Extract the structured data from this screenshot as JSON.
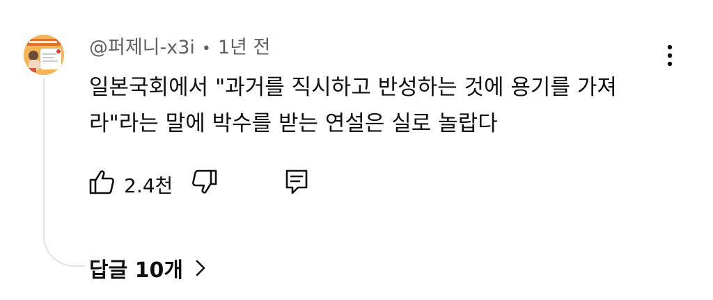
{
  "comment": {
    "author": "@퍼제니-x3i",
    "separator": "•",
    "time": "1년 전",
    "text": "일본국회에서 \"과거를 직시하고 반성하는 것에 용기를 가져라\"라는 말에 박수를 받는 연설은 실로 놀랍다",
    "like_count": "2.4천",
    "replies_label": "답글 10개"
  },
  "icons": {
    "like": "thumbs-up-icon",
    "dislike": "thumbs-down-icon",
    "reply": "comment-icon",
    "more": "more-vertical-icon",
    "chevron": "chevron-right-icon"
  },
  "colors": {
    "text": "#0f0f0f",
    "secondary": "#606060",
    "thread_line": "#e2e2e2"
  }
}
